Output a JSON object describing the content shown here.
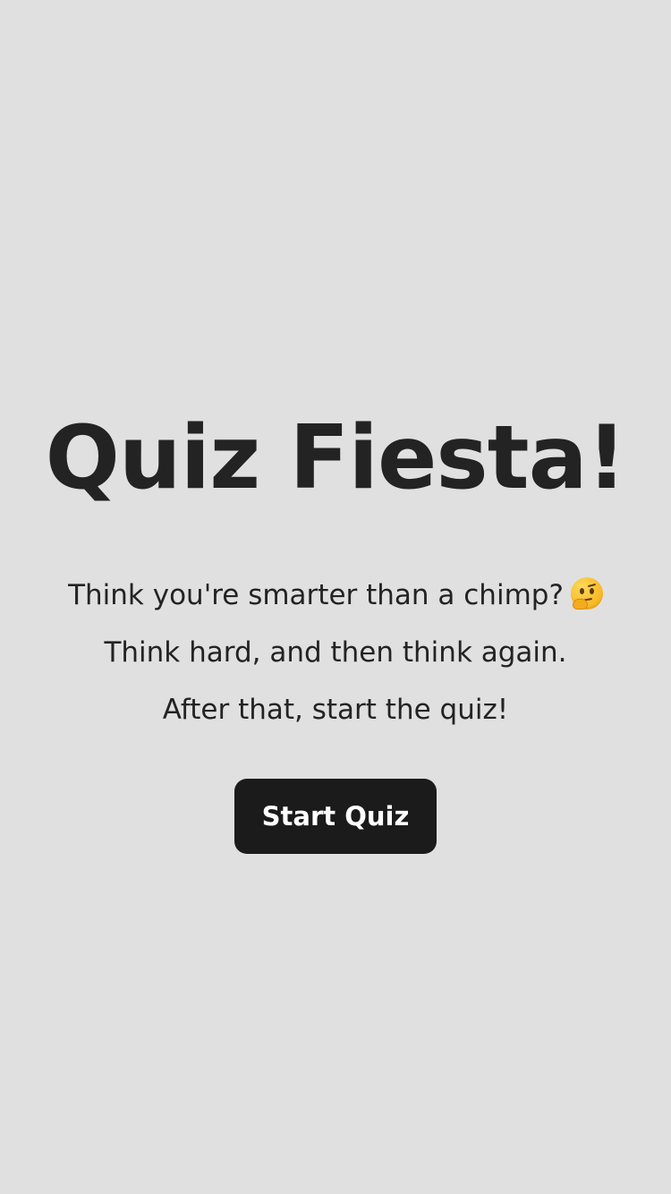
{
  "hero": {
    "title": "Quiz Fiesta!"
  },
  "intro": {
    "line1": "Think you're smarter than a chimp?",
    "line1_icon": "thinking-face-icon",
    "line2": "Think hard, and then think again.",
    "line3": "After that, start the quiz!"
  },
  "actions": {
    "start_label": "Start Quiz"
  },
  "colors": {
    "background": "#e0e0e0",
    "text": "#232323",
    "button_background": "#1b1b1b",
    "button_text": "#ffffff"
  }
}
